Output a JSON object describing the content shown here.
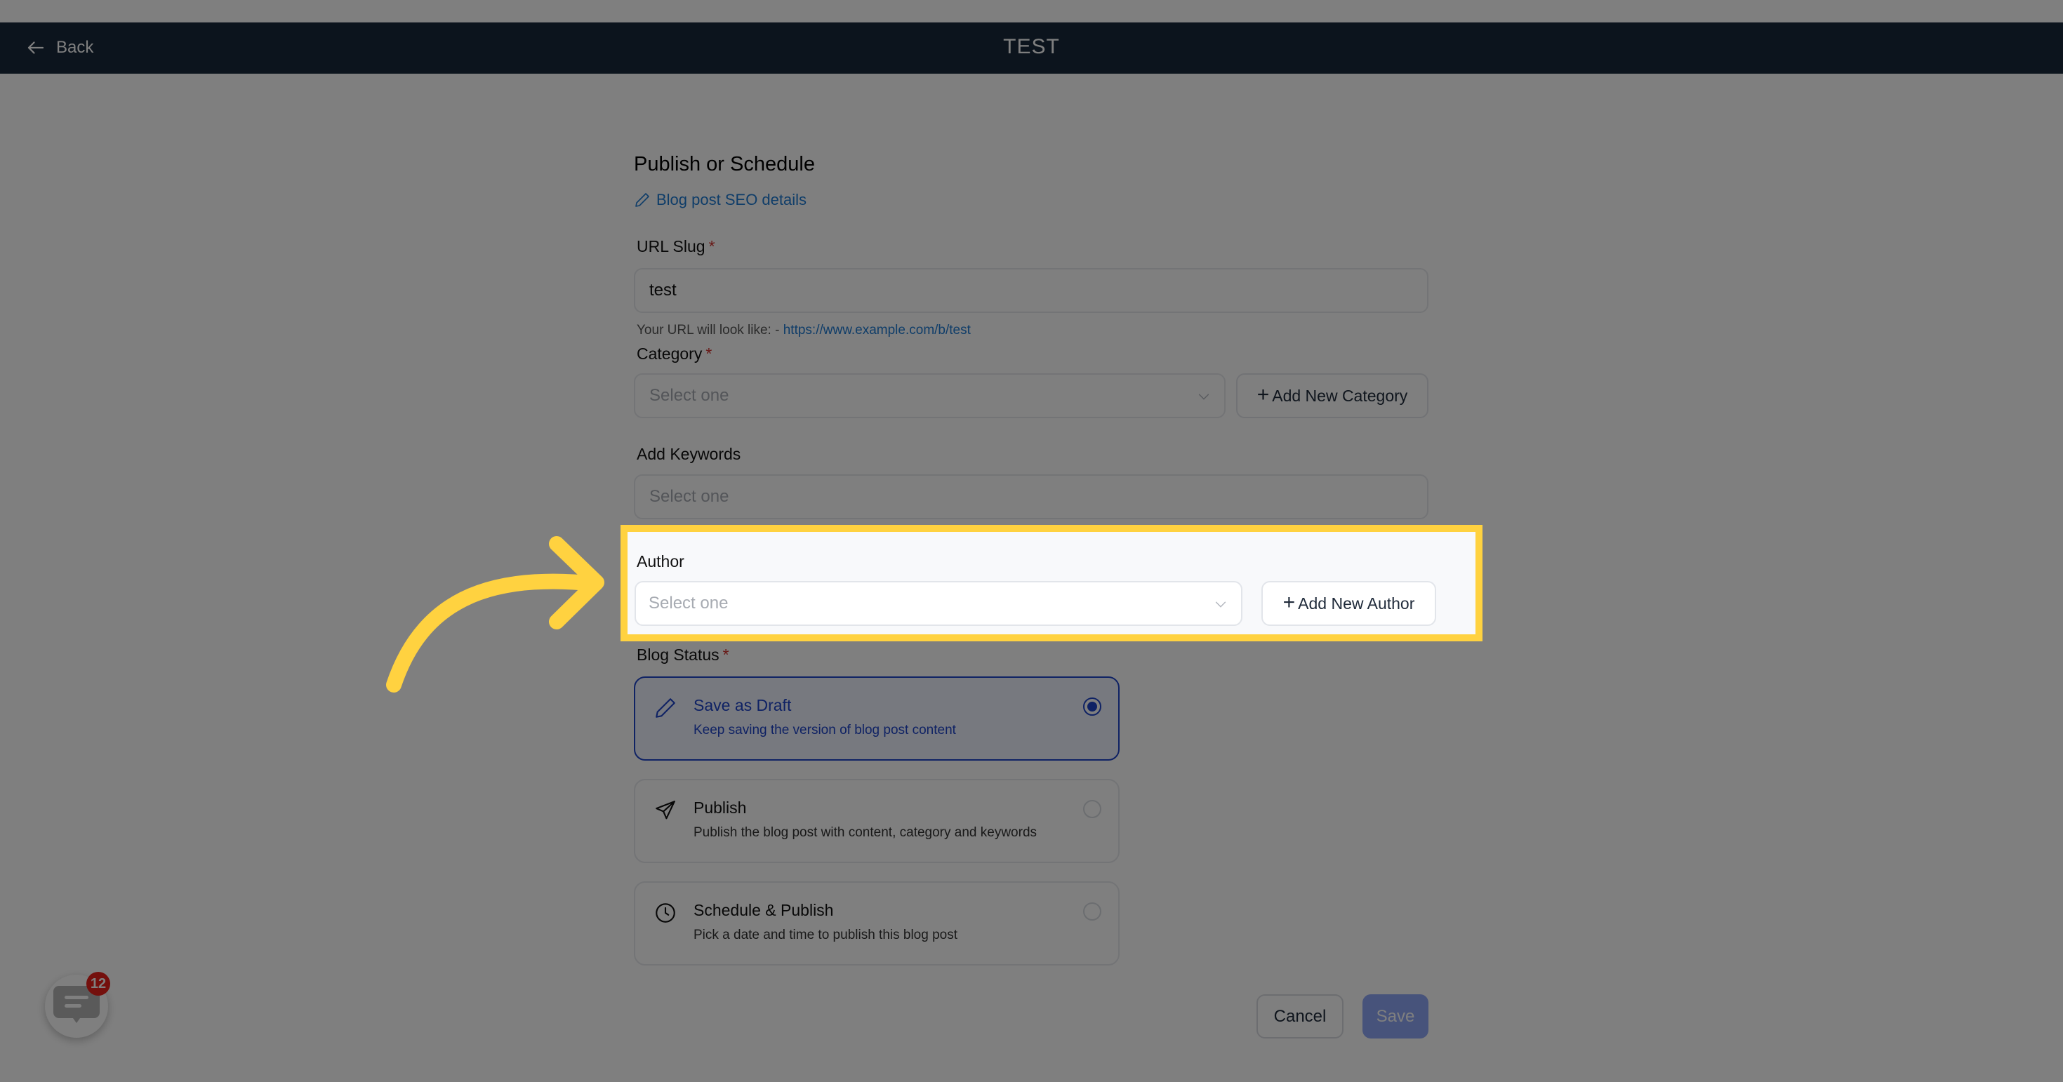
{
  "navbar": {
    "back_label": "Back",
    "title": "TEST"
  },
  "form": {
    "heading": "Publish or Schedule",
    "seo_link": "Blog post SEO details",
    "url_slug": {
      "label": "URL Slug",
      "required": "*",
      "value": "test",
      "helper_prefix": "Your URL will look like: - ",
      "helper_url": "https://www.example.com/b/test"
    },
    "category": {
      "label": "Category",
      "required": "*",
      "placeholder": "Select one",
      "add_button": "Add New Category"
    },
    "keywords": {
      "label": "Add Keywords",
      "placeholder": "Select one"
    },
    "author": {
      "label": "Author",
      "placeholder": "Select one",
      "add_button": "Add New Author"
    },
    "blog_status": {
      "label": "Blog Status",
      "required": "*",
      "options": [
        {
          "title": "Save as Draft",
          "description": "Keep saving the version of blog post content",
          "icon": "pencil-icon",
          "selected": true
        },
        {
          "title": "Publish",
          "description": "Publish the blog post with content, category and keywords",
          "icon": "send-icon",
          "selected": false
        },
        {
          "title": "Schedule & Publish",
          "description": "Pick a date and time to publish this blog post",
          "icon": "clock-icon",
          "selected": false
        }
      ]
    },
    "cancel_label": "Cancel",
    "save_label": "Save"
  },
  "chat_widget": {
    "badge_count": "12"
  },
  "annotation": {
    "highlight_color": "#ffd240"
  },
  "colors": {
    "accent": "#1f44c8",
    "link": "#1f7ad2",
    "navbar": "#18293a"
  }
}
